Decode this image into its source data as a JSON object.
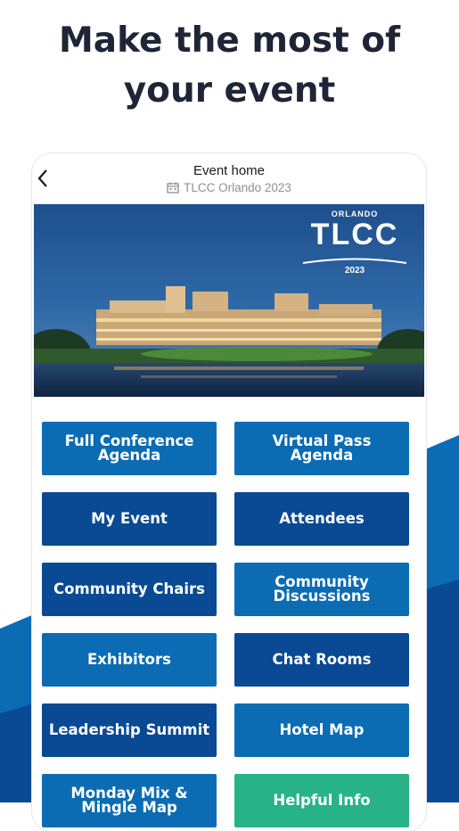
{
  "headline": {
    "line1": "Make the most of",
    "line2": "your event"
  },
  "colors": {
    "headline_text": "#1e2536",
    "background_blue_dark": "#0a4a94",
    "background_blue_light": "#0b6cb4",
    "tile_light": "#0b6cb4",
    "tile_dark": "#0a4a94",
    "tile_green": "#27b385"
  },
  "topbar": {
    "back_icon": "chevron-left-icon",
    "title": "Event home",
    "subtitle_icon": "calendar-icon",
    "subtitle": "TLCC Orlando 2023"
  },
  "hero": {
    "logo_city": "ORLANDO",
    "logo_name": "TLCC",
    "logo_year": "2023"
  },
  "tiles": [
    {
      "label": "Full Conference Agenda",
      "color": "light"
    },
    {
      "label": "Virtual Pass Agenda",
      "color": "light"
    },
    {
      "label": "My Event",
      "color": "dark"
    },
    {
      "label": "Attendees",
      "color": "dark"
    },
    {
      "label": "Community Chairs",
      "color": "dark"
    },
    {
      "label": "Community Discussions",
      "color": "light"
    },
    {
      "label": "Exhibitors",
      "color": "light"
    },
    {
      "label": "Chat Rooms",
      "color": "dark"
    },
    {
      "label": "Leadership Summit",
      "color": "dark"
    },
    {
      "label": "Hotel Map",
      "color": "light"
    },
    {
      "label": "Monday Mix & Mingle Map",
      "color": "light"
    },
    {
      "label": "Helpful Info",
      "color": "green"
    }
  ]
}
